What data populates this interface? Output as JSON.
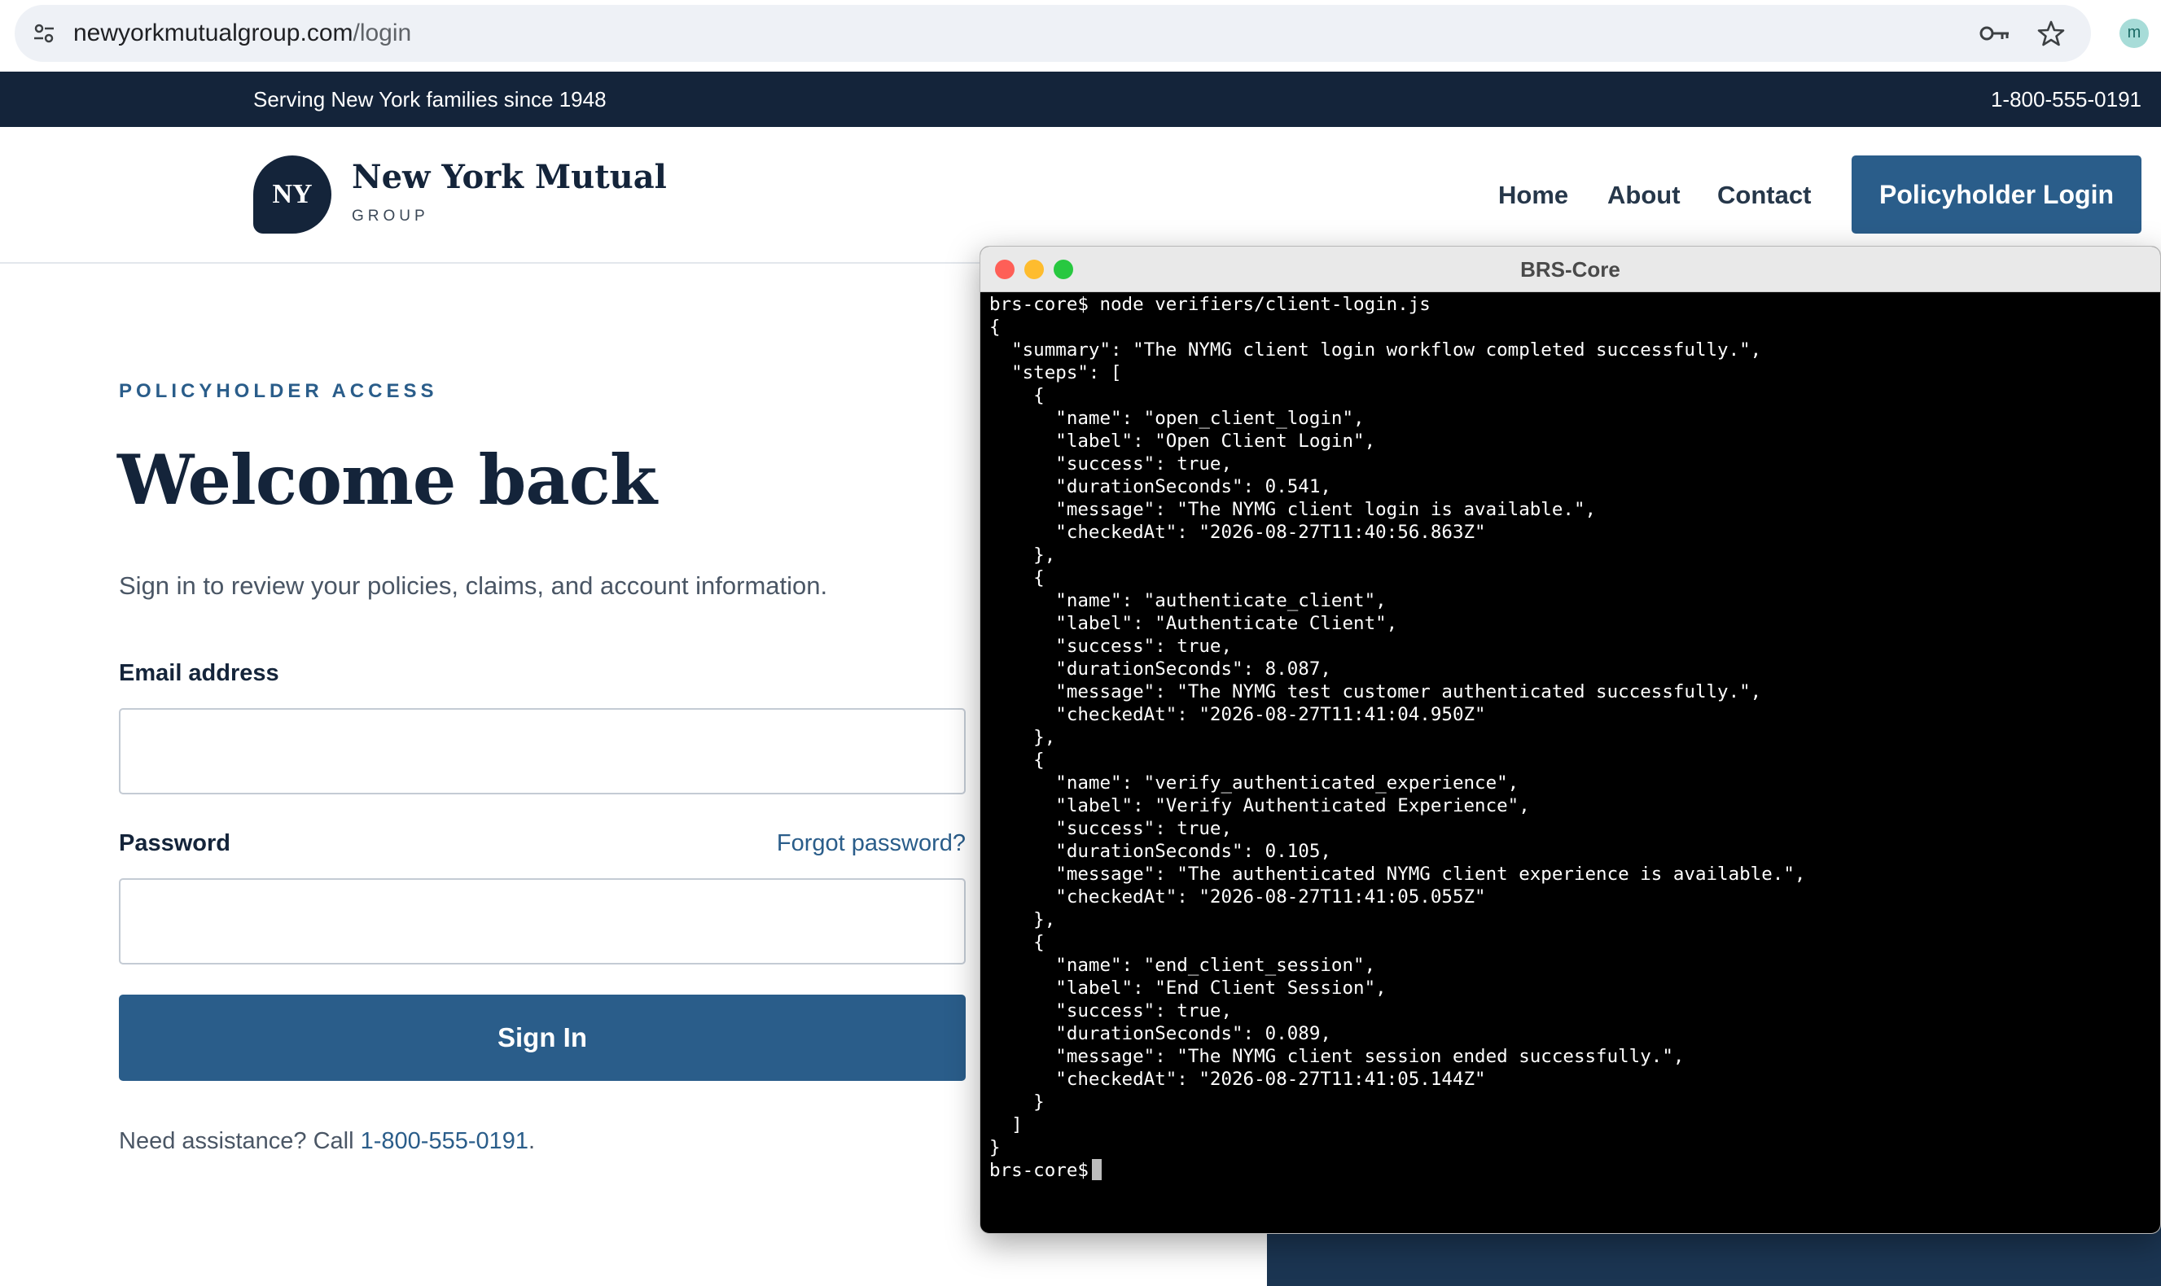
{
  "browser": {
    "url_host": "newyorkmutualgroup.com",
    "url_path": "/login",
    "profile_initial": "m"
  },
  "topbar": {
    "tagline": "Serving New York families since 1948",
    "phone": "1-800-555-0191"
  },
  "header": {
    "logo_mark": "NY",
    "logo_name": "New York Mutual",
    "logo_sub": "GROUP",
    "nav": [
      "Home",
      "About",
      "Contact"
    ],
    "login_button": "Policyholder Login"
  },
  "login": {
    "eyebrow": "POLICYHOLDER ACCESS",
    "title": "Welcome back",
    "lede": "Sign in to review your policies, claims, and account information.",
    "email_label": "Email address",
    "email_value": "",
    "password_label": "Password",
    "password_value": "",
    "forgot_link": "Forgot password?",
    "submit_label": "Sign In",
    "assist_prefix": "Need assistance? Call ",
    "assist_phone": "1-800-555-0191",
    "assist_suffix": "."
  },
  "terminal": {
    "title": "BRS-Core",
    "lines": [
      "brs-core$ node verifiers/client-login.js",
      "{",
      "  \"summary\": \"The NYMG client login workflow completed successfully.\",",
      "  \"steps\": [",
      "    {",
      "      \"name\": \"open_client_login\",",
      "      \"label\": \"Open Client Login\",",
      "      \"success\": true,",
      "      \"durationSeconds\": 0.541,",
      "      \"message\": \"The NYMG client login is available.\",",
      "      \"checkedAt\": \"2026-08-27T11:40:56.863Z\"",
      "    },",
      "    {",
      "      \"name\": \"authenticate_client\",",
      "      \"label\": \"Authenticate Client\",",
      "      \"success\": true,",
      "      \"durationSeconds\": 8.087,",
      "      \"message\": \"The NYMG test customer authenticated successfully.\",",
      "      \"checkedAt\": \"2026-08-27T11:41:04.950Z\"",
      "    },",
      "    {",
      "      \"name\": \"verify_authenticated_experience\",",
      "      \"label\": \"Verify Authenticated Experience\",",
      "      \"success\": true,",
      "      \"durationSeconds\": 0.105,",
      "      \"message\": \"The authenticated NYMG client experience is available.\",",
      "      \"checkedAt\": \"2026-08-27T11:41:05.055Z\"",
      "    },",
      "    {",
      "      \"name\": \"end_client_session\",",
      "      \"label\": \"End Client Session\",",
      "      \"success\": true,",
      "      \"durationSeconds\": 0.089,",
      "      \"message\": \"The NYMG client session ended successfully.\",",
      "      \"checkedAt\": \"2026-08-27T11:41:05.144Z\"",
      "    }",
      "  ]",
      "}"
    ],
    "prompt": "brs-core$"
  },
  "colors": {
    "navy": "#14243a",
    "brand_blue": "#2a5d8a",
    "terminal_bg": "#000000"
  },
  "icons": [
    "tune-icon",
    "key-icon",
    "star-icon",
    "cursor-block"
  ]
}
